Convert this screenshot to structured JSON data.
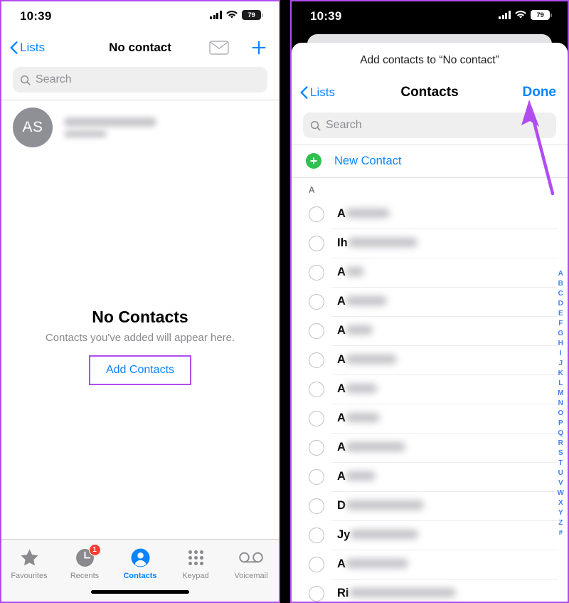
{
  "left_phone": {
    "status_bar": {
      "time": "10:39",
      "battery_level": "79",
      "cellular_icon": "signal-bars-icon",
      "wifi_icon": "wifi-icon",
      "battery_icon": "battery-icon"
    },
    "nav": {
      "back_label": "Lists",
      "back_icon": "chevron-left-icon",
      "title": "No contact",
      "mail_icon": "envelope-icon",
      "add_icon": "plus-icon"
    },
    "search": {
      "placeholder": "Search",
      "icon": "search-icon"
    },
    "my_card": {
      "avatar_initials": "AS"
    },
    "empty_state": {
      "title": "No Contacts",
      "subtitle": "Contacts you've added will appear here.",
      "button_label": "Add Contacts",
      "highlight_color": "#b14df0"
    },
    "tabs": [
      {
        "label": "Favourites",
        "icon": "star-icon",
        "active": false,
        "badge": ""
      },
      {
        "label": "Recents",
        "icon": "clock-icon",
        "active": false,
        "badge": "1"
      },
      {
        "label": "Contacts",
        "icon": "person-circle-icon",
        "active": true,
        "badge": ""
      },
      {
        "label": "Keypad",
        "icon": "keypad-dots-icon",
        "active": false,
        "badge": ""
      },
      {
        "label": "Voicemail",
        "icon": "voicemail-icon",
        "active": false,
        "badge": ""
      }
    ],
    "accent_color": "#0a84ff"
  },
  "right_phone": {
    "status_bar": {
      "time": "10:39",
      "battery_level": "79"
    },
    "sheet": {
      "header": "Add contacts to “No contact”",
      "nav": {
        "back_label": "Lists",
        "title": "Contacts",
        "done_label": "Done"
      },
      "search": {
        "placeholder": "Search",
        "icon": "search-icon"
      },
      "new_contact": {
        "label": "New Contact",
        "icon": "plus-circle-icon",
        "icon_color": "#2ec14e"
      },
      "section_header": "A",
      "rows": [
        {
          "visible_name": "A",
          "blur_width": 62
        },
        {
          "visible_name": "Ih",
          "blur_width": 98
        },
        {
          "visible_name": "A",
          "blur_width": 26
        },
        {
          "visible_name": "A",
          "blur_width": 58
        },
        {
          "visible_name": "A",
          "blur_width": 38
        },
        {
          "visible_name": "A",
          "blur_width": 72
        },
        {
          "visible_name": "A",
          "blur_width": 44
        },
        {
          "visible_name": "A",
          "blur_width": 48
        },
        {
          "visible_name": "A",
          "blur_width": 84
        },
        {
          "visible_name": "A",
          "blur_width": 42
        },
        {
          "visible_name": "D",
          "blur_width": 110
        },
        {
          "visible_name": "Jy",
          "blur_width": 96
        },
        {
          "visible_name": "A",
          "blur_width": 88
        },
        {
          "visible_name": "Ri",
          "blur_width": 150
        }
      ],
      "alphabet_index": [
        "A",
        "B",
        "C",
        "D",
        "E",
        "F",
        "G",
        "H",
        "I",
        "J",
        "K",
        "L",
        "M",
        "N",
        "O",
        "P",
        "Q",
        "R",
        "S",
        "T",
        "U",
        "V",
        "W",
        "X",
        "Y",
        "Z",
        "#"
      ]
    },
    "annotation": {
      "arrow_color": "#b14df0",
      "points_to": "Done"
    }
  }
}
